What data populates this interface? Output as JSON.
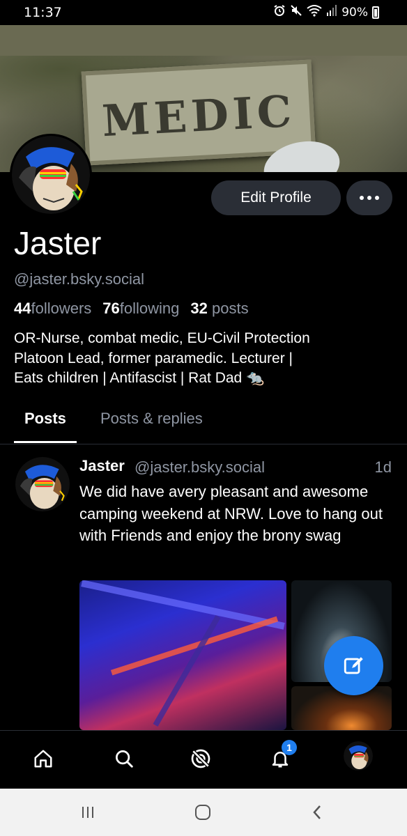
{
  "status_bar": {
    "time": "11:37",
    "battery": "90%",
    "icons": [
      "alarm-icon",
      "mute-icon",
      "wifi-icon",
      "signal-icon",
      "battery-icon"
    ]
  },
  "banner": {
    "patch_text": "MEDIC"
  },
  "profile": {
    "display_name": "Jaster",
    "handle": "@jaster.bsky.social",
    "followers_count": "44",
    "followers_label": "followers",
    "following_count": "76",
    "following_label": "following",
    "posts_count": "32",
    "posts_label": "posts",
    "bio_line1": "OR-Nurse, combat medic, EU-Civil Protection",
    "bio_line2": "Platoon Lead, former paramedic.  Lecturer |",
    "bio_line3": "Eats children | Antifascist | Rat Dad 🐀"
  },
  "actions": {
    "edit_profile": "Edit Profile",
    "more_icon": "more-horizontal-icon"
  },
  "tabs": [
    {
      "label": "Posts",
      "active": true
    },
    {
      "label": "Posts & replies",
      "active": false
    }
  ],
  "post": {
    "author": "Jaster",
    "handle": "@jaster.bsky.social",
    "time": "1d",
    "text": "We did have avery pleasant and awesome camping weekend at NRW. Love to hang out with Friends and enjoy the brony swag"
  },
  "bottom_nav": {
    "items": [
      "home-icon",
      "search-icon",
      "feeds-icon",
      "notifications-icon",
      "profile-avatar"
    ],
    "notifications_badge": "1"
  },
  "colors": {
    "accent": "#1f7eee",
    "muted_text": "#8f96a3",
    "button_bg": "#2a2e36"
  }
}
